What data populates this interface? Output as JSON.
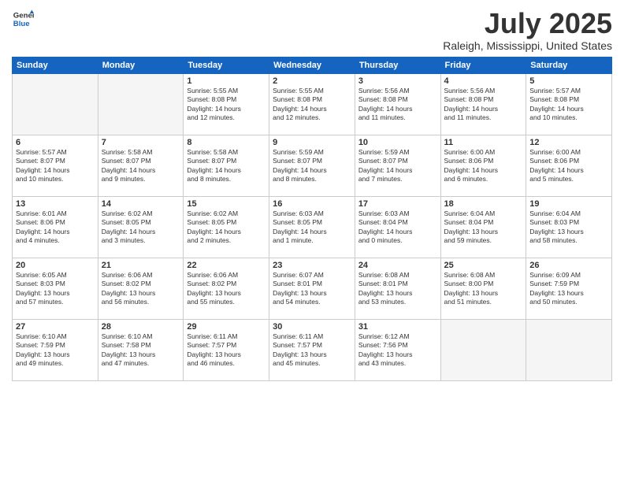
{
  "header": {
    "logo_general": "General",
    "logo_blue": "Blue",
    "title": "July 2025",
    "location": "Raleigh, Mississippi, United States"
  },
  "days_of_week": [
    "Sunday",
    "Monday",
    "Tuesday",
    "Wednesday",
    "Thursday",
    "Friday",
    "Saturday"
  ],
  "weeks": [
    [
      {
        "num": "",
        "info": ""
      },
      {
        "num": "",
        "info": ""
      },
      {
        "num": "1",
        "info": "Sunrise: 5:55 AM\nSunset: 8:08 PM\nDaylight: 14 hours\nand 12 minutes."
      },
      {
        "num": "2",
        "info": "Sunrise: 5:55 AM\nSunset: 8:08 PM\nDaylight: 14 hours\nand 12 minutes."
      },
      {
        "num": "3",
        "info": "Sunrise: 5:56 AM\nSunset: 8:08 PM\nDaylight: 14 hours\nand 11 minutes."
      },
      {
        "num": "4",
        "info": "Sunrise: 5:56 AM\nSunset: 8:08 PM\nDaylight: 14 hours\nand 11 minutes."
      },
      {
        "num": "5",
        "info": "Sunrise: 5:57 AM\nSunset: 8:08 PM\nDaylight: 14 hours\nand 10 minutes."
      }
    ],
    [
      {
        "num": "6",
        "info": "Sunrise: 5:57 AM\nSunset: 8:07 PM\nDaylight: 14 hours\nand 10 minutes."
      },
      {
        "num": "7",
        "info": "Sunrise: 5:58 AM\nSunset: 8:07 PM\nDaylight: 14 hours\nand 9 minutes."
      },
      {
        "num": "8",
        "info": "Sunrise: 5:58 AM\nSunset: 8:07 PM\nDaylight: 14 hours\nand 8 minutes."
      },
      {
        "num": "9",
        "info": "Sunrise: 5:59 AM\nSunset: 8:07 PM\nDaylight: 14 hours\nand 8 minutes."
      },
      {
        "num": "10",
        "info": "Sunrise: 5:59 AM\nSunset: 8:07 PM\nDaylight: 14 hours\nand 7 minutes."
      },
      {
        "num": "11",
        "info": "Sunrise: 6:00 AM\nSunset: 8:06 PM\nDaylight: 14 hours\nand 6 minutes."
      },
      {
        "num": "12",
        "info": "Sunrise: 6:00 AM\nSunset: 8:06 PM\nDaylight: 14 hours\nand 5 minutes."
      }
    ],
    [
      {
        "num": "13",
        "info": "Sunrise: 6:01 AM\nSunset: 8:06 PM\nDaylight: 14 hours\nand 4 minutes."
      },
      {
        "num": "14",
        "info": "Sunrise: 6:02 AM\nSunset: 8:05 PM\nDaylight: 14 hours\nand 3 minutes."
      },
      {
        "num": "15",
        "info": "Sunrise: 6:02 AM\nSunset: 8:05 PM\nDaylight: 14 hours\nand 2 minutes."
      },
      {
        "num": "16",
        "info": "Sunrise: 6:03 AM\nSunset: 8:05 PM\nDaylight: 14 hours\nand 1 minute."
      },
      {
        "num": "17",
        "info": "Sunrise: 6:03 AM\nSunset: 8:04 PM\nDaylight: 14 hours\nand 0 minutes."
      },
      {
        "num": "18",
        "info": "Sunrise: 6:04 AM\nSunset: 8:04 PM\nDaylight: 13 hours\nand 59 minutes."
      },
      {
        "num": "19",
        "info": "Sunrise: 6:04 AM\nSunset: 8:03 PM\nDaylight: 13 hours\nand 58 minutes."
      }
    ],
    [
      {
        "num": "20",
        "info": "Sunrise: 6:05 AM\nSunset: 8:03 PM\nDaylight: 13 hours\nand 57 minutes."
      },
      {
        "num": "21",
        "info": "Sunrise: 6:06 AM\nSunset: 8:02 PM\nDaylight: 13 hours\nand 56 minutes."
      },
      {
        "num": "22",
        "info": "Sunrise: 6:06 AM\nSunset: 8:02 PM\nDaylight: 13 hours\nand 55 minutes."
      },
      {
        "num": "23",
        "info": "Sunrise: 6:07 AM\nSunset: 8:01 PM\nDaylight: 13 hours\nand 54 minutes."
      },
      {
        "num": "24",
        "info": "Sunrise: 6:08 AM\nSunset: 8:01 PM\nDaylight: 13 hours\nand 53 minutes."
      },
      {
        "num": "25",
        "info": "Sunrise: 6:08 AM\nSunset: 8:00 PM\nDaylight: 13 hours\nand 51 minutes."
      },
      {
        "num": "26",
        "info": "Sunrise: 6:09 AM\nSunset: 7:59 PM\nDaylight: 13 hours\nand 50 minutes."
      }
    ],
    [
      {
        "num": "27",
        "info": "Sunrise: 6:10 AM\nSunset: 7:59 PM\nDaylight: 13 hours\nand 49 minutes."
      },
      {
        "num": "28",
        "info": "Sunrise: 6:10 AM\nSunset: 7:58 PM\nDaylight: 13 hours\nand 47 minutes."
      },
      {
        "num": "29",
        "info": "Sunrise: 6:11 AM\nSunset: 7:57 PM\nDaylight: 13 hours\nand 46 minutes."
      },
      {
        "num": "30",
        "info": "Sunrise: 6:11 AM\nSunset: 7:57 PM\nDaylight: 13 hours\nand 45 minutes."
      },
      {
        "num": "31",
        "info": "Sunrise: 6:12 AM\nSunset: 7:56 PM\nDaylight: 13 hours\nand 43 minutes."
      },
      {
        "num": "",
        "info": ""
      },
      {
        "num": "",
        "info": ""
      }
    ]
  ]
}
